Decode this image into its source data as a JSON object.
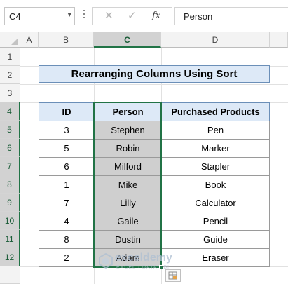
{
  "formula_bar": {
    "name_box": "C4",
    "name_box_arrow": "▾",
    "cancel_icon": "✕",
    "enter_icon": "✓",
    "fx_label": "fx",
    "content": "Person"
  },
  "columns": [
    "A",
    "B",
    "C",
    "D"
  ],
  "rows": [
    "1",
    "2",
    "3",
    "4",
    "5",
    "6",
    "7",
    "8",
    "9",
    "10",
    "11",
    "12"
  ],
  "selected_cell": "C4",
  "title": "Rearranging Columns Using Sort",
  "table": {
    "headers": [
      "ID",
      "Person",
      "Purchased Products"
    ],
    "rows": [
      [
        "3",
        "Stephen",
        "Pen"
      ],
      [
        "5",
        "Robin",
        "Marker"
      ],
      [
        "6",
        "Milford",
        "Stapler"
      ],
      [
        "1",
        "Mike",
        "Book"
      ],
      [
        "7",
        "Lilly",
        "Calculator"
      ],
      [
        "4",
        "Gaile",
        "Pencil"
      ],
      [
        "8",
        "Dustin",
        "Guide"
      ],
      [
        "2",
        "Adam",
        "Eraser"
      ]
    ]
  },
  "watermark": {
    "name": "exceldemy",
    "sub": "EXCEL · DATA · BI"
  },
  "colors": {
    "header_fill": "#dde9f7",
    "selected_column_fill": "#cfcfcf",
    "selection_border": "#217346"
  }
}
